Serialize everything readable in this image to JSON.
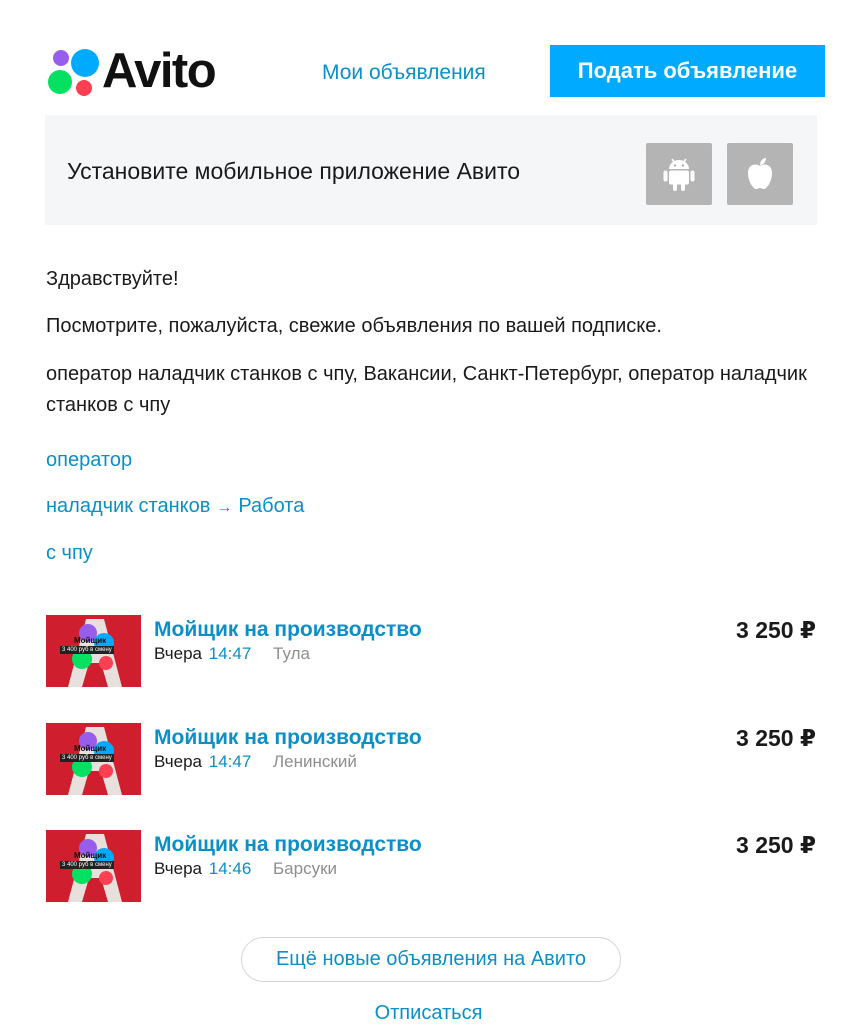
{
  "header": {
    "logo_text": "Avito",
    "my_ads_label": "Мои объявления",
    "post_ad_label": "Подать объявление"
  },
  "app_banner": {
    "text": "Установите мобильное приложение Авито",
    "android_icon": "android-icon",
    "apple_icon": "apple-icon"
  },
  "body": {
    "greeting": "Здравствуйте!",
    "intro": "Посмотрите, пожалуйста, свежие объявления по вашей подписке.",
    "subscription": "оператор наладчик станков с чпу, Вакансии, Санкт-Петербург, оператор наладчик станков с чпу"
  },
  "tags": {
    "tag1": "оператор",
    "tag2": "наладчик станков",
    "tag2_arrow": "→",
    "tag2_category": "Работа",
    "tag3": "с чпу"
  },
  "listings": [
    {
      "title": "Мойщик на производство",
      "day": "Вчера",
      "time": "14:47",
      "location": "Тула",
      "price": "3 250 ₽",
      "thumb_label": "Мойщик",
      "thumb_sublabel": "3 400 руб в смену"
    },
    {
      "title": "Мойщик на производство",
      "day": "Вчера",
      "time": "14:47",
      "location": "Ленинский",
      "price": "3 250 ₽",
      "thumb_label": "Мойщик",
      "thumb_sublabel": "3 400 руб в смену"
    },
    {
      "title": "Мойщик на производство",
      "day": "Вчера",
      "time": "14:46",
      "location": "Барсуки",
      "price": "3 250 ₽",
      "thumb_label": "Мойщик",
      "thumb_sublabel": "3 400 руб в смену"
    }
  ],
  "footer": {
    "more_label": "Ещё новые объявления на Авито",
    "unsubscribe_label": "Отписаться"
  },
  "colors": {
    "accent": "#00aaff",
    "link": "#0a8fc7",
    "thumb_bg": "#cf1f2e"
  }
}
